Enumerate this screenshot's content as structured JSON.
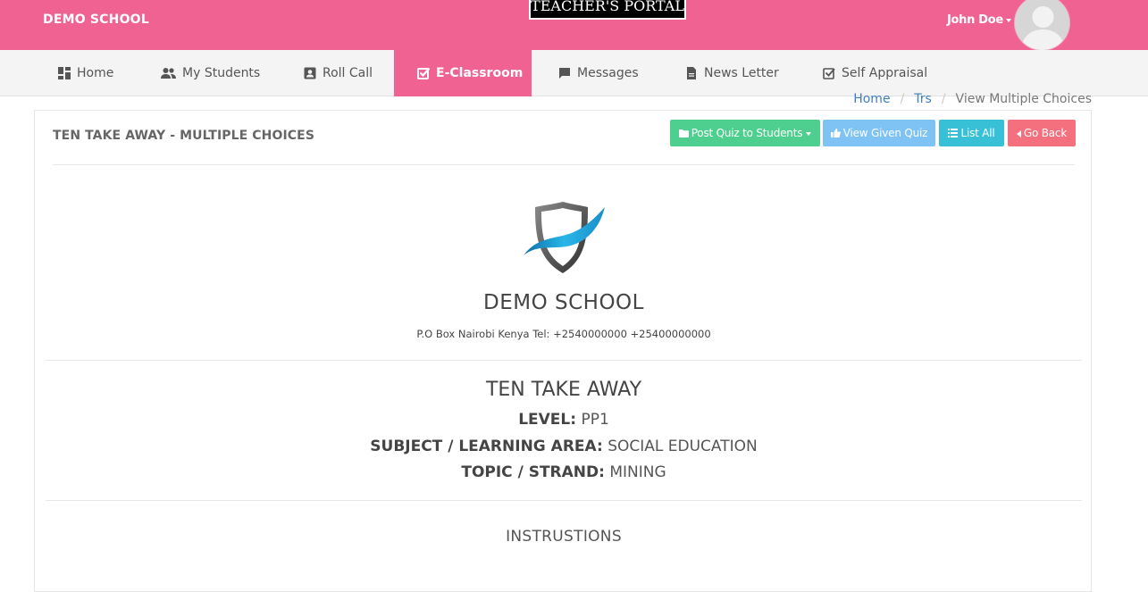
{
  "header": {
    "brand": "DEMO SCHOOL",
    "portal_label": "TEACHER'S PORTAL",
    "user_name": "John Doe",
    "accent_color": "#f06292"
  },
  "nav": {
    "items": [
      {
        "label": "Home",
        "icon": "dashboard-icon"
      },
      {
        "label": "My Students",
        "icon": "people-icon"
      },
      {
        "label": "Roll Call",
        "icon": "contact-card-icon"
      },
      {
        "label": "E-Classroom",
        "icon": "checked-box-icon",
        "active": true
      },
      {
        "label": "Messages",
        "icon": "chat-bubble-icon"
      },
      {
        "label": "News Letter",
        "icon": "document-icon"
      },
      {
        "label": "Self Appraisal",
        "icon": "checkbox-icon"
      }
    ]
  },
  "breadcrumb": {
    "items": [
      "Home",
      "Trs",
      "View Multiple Choices"
    ],
    "separator": "/"
  },
  "panel": {
    "title": "TEN TAKE AWAY - MULTIPLE CHOICES",
    "buttons": {
      "post_quiz": "Post Quiz to Students",
      "view_given": "View Given Quiz",
      "list_all": "List All",
      "go_back": "Go Back"
    },
    "school": {
      "name": "DEMO SCHOOL",
      "contact": "P.O Box Nairobi Kenya Tel: +2540000000 +25400000000"
    },
    "quiz": {
      "title": "TEN TAKE AWAY",
      "level_label": "LEVEL:",
      "level_value": "PP1",
      "subject_label": "SUBJECT / LEARNING AREA:",
      "subject_value": "SOCIAL EDUCATION",
      "topic_label": "TOPIC / STRAND:",
      "topic_value": "MINING"
    },
    "instructions_heading": "INSTRUSTIONS"
  }
}
